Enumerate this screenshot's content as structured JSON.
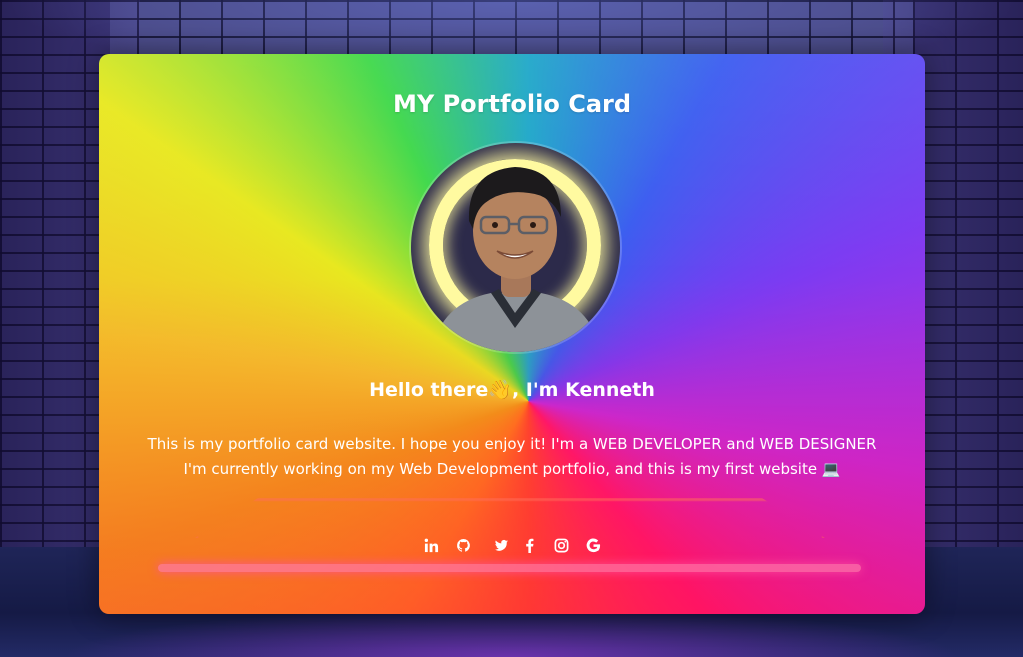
{
  "card": {
    "title": "MY Portfolio Card",
    "greeting": "Hello there👋, I'm Kenneth",
    "bio": "This is my portfolio card website. I hope you enjoy it! I'm a WEB DEVELOPER and WEB DESIGNER I'm currently working on my Web Development portfolio, and this is my first website 💻"
  },
  "socials": [
    {
      "icon": "linkedin-icon"
    },
    {
      "icon": "github-icon"
    },
    {
      "icon": "twitter-icon"
    },
    {
      "icon": "facebook-icon"
    },
    {
      "icon": "instagram-icon"
    },
    {
      "icon": "google-icon"
    }
  ],
  "colors": {
    "text": "#ffffff",
    "avatar_ring": "#fffaa0",
    "neon": "#ff78aa"
  }
}
